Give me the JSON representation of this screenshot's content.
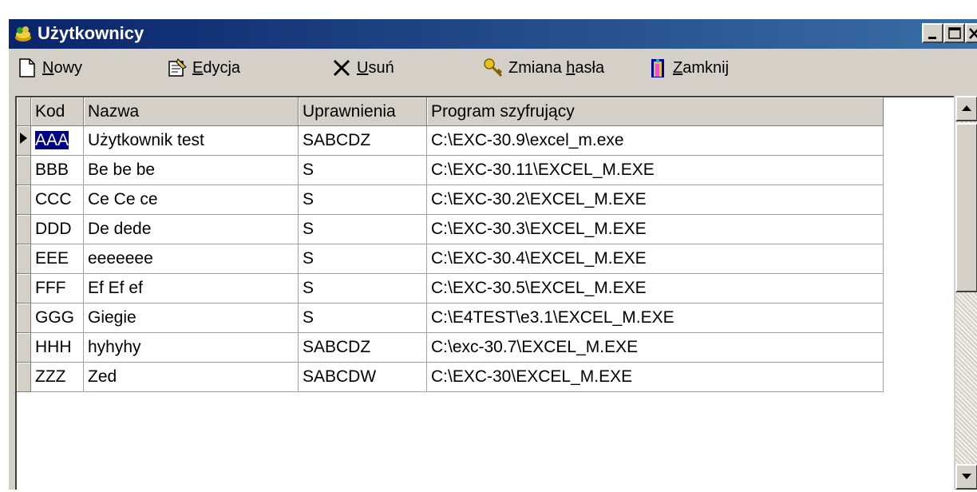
{
  "window": {
    "title": "Użytkownicy"
  },
  "toolbar": {
    "new_label": "Nowy",
    "edit_label": "Edycja",
    "delete_label": "Usuń",
    "password_label_pre": "Zmiana ",
    "password_label_accel": "h",
    "password_label_post": "asła",
    "close_label": "Zamknij",
    "new_accel": "N",
    "new_rest": "owy",
    "edit_accel": "E",
    "edit_rest": "dycja",
    "delete_accel": "U",
    "delete_rest": "suń",
    "close_accel": "Z",
    "close_rest": "amknij"
  },
  "table": {
    "columns": [
      "Kod",
      "Nazwa",
      "Uprawnienia",
      "Program szyfrujący"
    ],
    "rows": [
      [
        "AAA",
        "Użytkownik test",
        "SABCDZ",
        "C:\\EXC-30.9\\excel_m.exe"
      ],
      [
        "BBB",
        "Be be be",
        "S",
        "C:\\EXC-30.11\\EXCEL_M.EXE"
      ],
      [
        "CCC",
        "Ce Ce ce",
        "S",
        "C:\\EXC-30.2\\EXCEL_M.EXE"
      ],
      [
        "DDD",
        "De dede",
        "S",
        "C:\\EXC-30.3\\EXCEL_M.EXE"
      ],
      [
        "EEE",
        "eeeeeee",
        "S",
        "C:\\EXC-30.4\\EXCEL_M.EXE"
      ],
      [
        "FFF",
        "Ef Ef ef",
        "S",
        "C:\\EXC-30.5\\EXCEL_M.EXE"
      ],
      [
        "GGG",
        "Giegie",
        "S",
        "C:\\E4TEST\\e3.1\\EXCEL_M.EXE"
      ],
      [
        "HHH",
        "hyhyhy",
        "SABCDZ",
        "C:\\exc-30.7\\EXCEL_M.EXE"
      ],
      [
        "ZZZ",
        "Zed",
        "SABCDW",
        "C:\\EXC-30\\EXCEL_M.EXE"
      ]
    ],
    "selected_row": 0
  },
  "icons": {
    "app": "users-app-icon",
    "new": "new-document-icon",
    "edit": "edit-document-icon",
    "delete": "delete-x-icon",
    "password": "key-icon",
    "close": "exit-door-icon"
  },
  "colors": {
    "titlebar_start": "#0a246a",
    "titlebar_end": "#3a6ea5",
    "selection": "#000080",
    "face": "#d4d0c8"
  }
}
